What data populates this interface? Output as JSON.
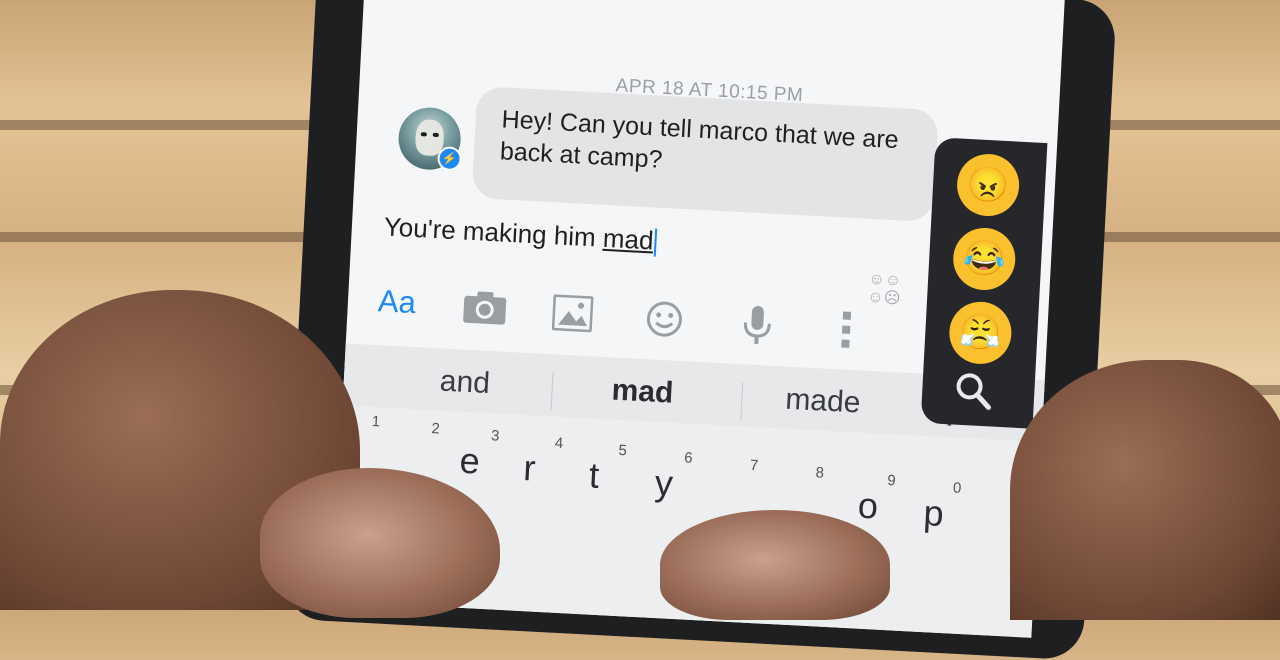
{
  "thread": {
    "timestamp": "APR 18 AT 10:15 PM",
    "incoming_message": "Hey! Can you tell marco that we are back at camp?"
  },
  "composer": {
    "text_prefix": "You're making him ",
    "text_highlight": "mad"
  },
  "toolbar": {
    "text_format_label": "Aa",
    "icons": [
      "camera-icon",
      "gallery-icon",
      "emoji-icon",
      "microphone-icon",
      "more-icon"
    ]
  },
  "keyboard": {
    "suggestions": [
      "and",
      "mad",
      "made"
    ],
    "top_letters": [
      "e",
      "r",
      "t",
      "y",
      "o",
      "p"
    ],
    "number_hints": [
      "1",
      "2",
      "3",
      "4",
      "5",
      "6",
      "7",
      "8",
      "9",
      "0"
    ]
  },
  "emoji_panel": {
    "items": [
      "😠",
      "😂",
      "😤"
    ],
    "search_icon": "search-icon"
  },
  "colors": {
    "accent": "#1e88f7",
    "bubble": "#e3e4e6",
    "emoji_yellow": "#fbc02d"
  }
}
